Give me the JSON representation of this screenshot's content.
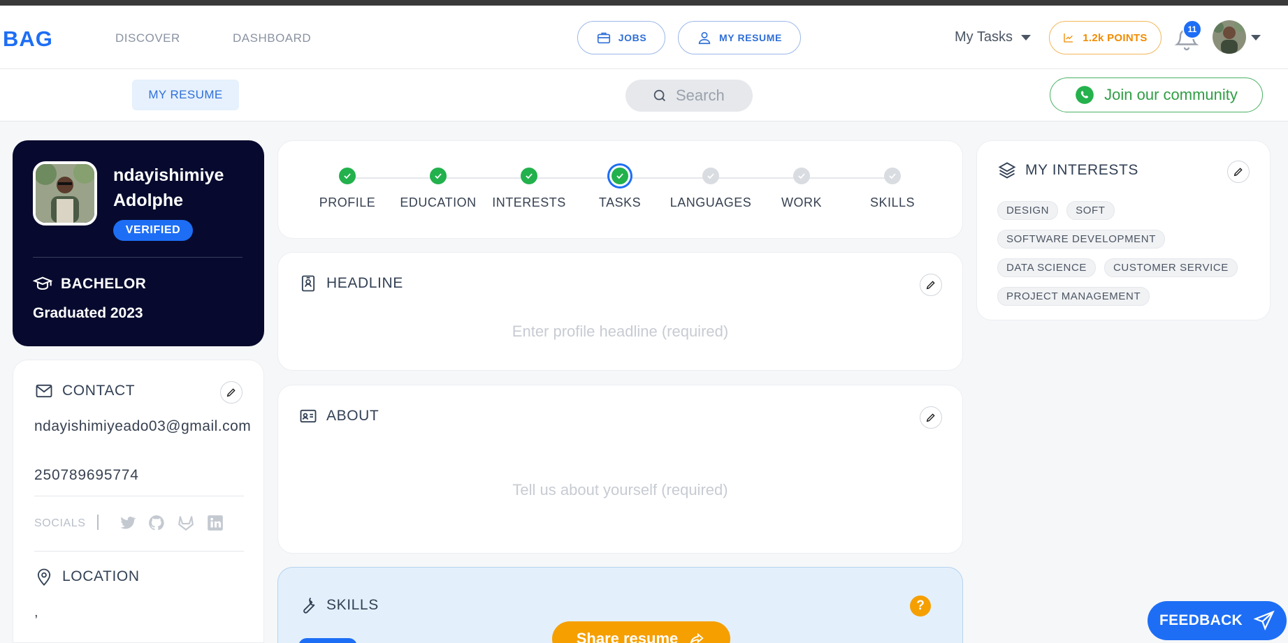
{
  "brand": {
    "logo_text": "BAG",
    "accent": "#1d6ef5"
  },
  "nav": {
    "links": [
      "DISCOVER",
      "DASHBOARD"
    ],
    "jobs_label": "JOBS",
    "my_resume_label": "MY RESUME",
    "my_tasks_label": "My Tasks",
    "points_label": "1.2k POINTS",
    "notification_count": "11"
  },
  "subbar": {
    "tab_label": "MY RESUME",
    "search_placeholder": "Search",
    "community_label": "Join our community"
  },
  "profile": {
    "name": "ndayishimiye Adolphe",
    "verified_label": "VERIFIED",
    "degree": "BACHELOR",
    "graduated": "Graduated 2023"
  },
  "contact": {
    "title": "CONTACT",
    "email": "ndayishimiyeado03@gmail.com",
    "phone": "250789695774",
    "socials_label": "SOCIALS",
    "social_icons": [
      "twitter-icon",
      "github-icon",
      "gitlab-icon",
      "linkedin-icon"
    ],
    "location_title": "LOCATION",
    "location_value": ","
  },
  "progress": {
    "steps": [
      {
        "label": "PROFILE",
        "state": "done"
      },
      {
        "label": "EDUCATION",
        "state": "done"
      },
      {
        "label": "INTERESTS",
        "state": "done"
      },
      {
        "label": "TASKS",
        "state": "current"
      },
      {
        "label": "LANGUAGES",
        "state": "pending"
      },
      {
        "label": "WORK",
        "state": "pending"
      },
      {
        "label": "SKILLS",
        "state": "pending"
      }
    ]
  },
  "headline": {
    "title": "HEADLINE",
    "placeholder": "Enter profile headline (required)"
  },
  "about": {
    "title": "ABOUT",
    "placeholder": "Tell us about yourself (required)"
  },
  "skills": {
    "title": "SKILLS",
    "help": "?"
  },
  "share_label": "Share resume",
  "interests": {
    "title": "MY INTERESTS",
    "tags": [
      "DESIGN",
      "SOFT",
      "SOFTWARE DEVELOPMENT",
      "DATA SCIENCE",
      "CUSTOMER SERVICE",
      "PROJECT MANAGEMENT"
    ]
  },
  "feedback_label": "FEEDBACK",
  "colors": {
    "success": "#22b14c",
    "warning": "#f59f00",
    "dark_card": "#070a2e",
    "community": "#2f9e44"
  }
}
